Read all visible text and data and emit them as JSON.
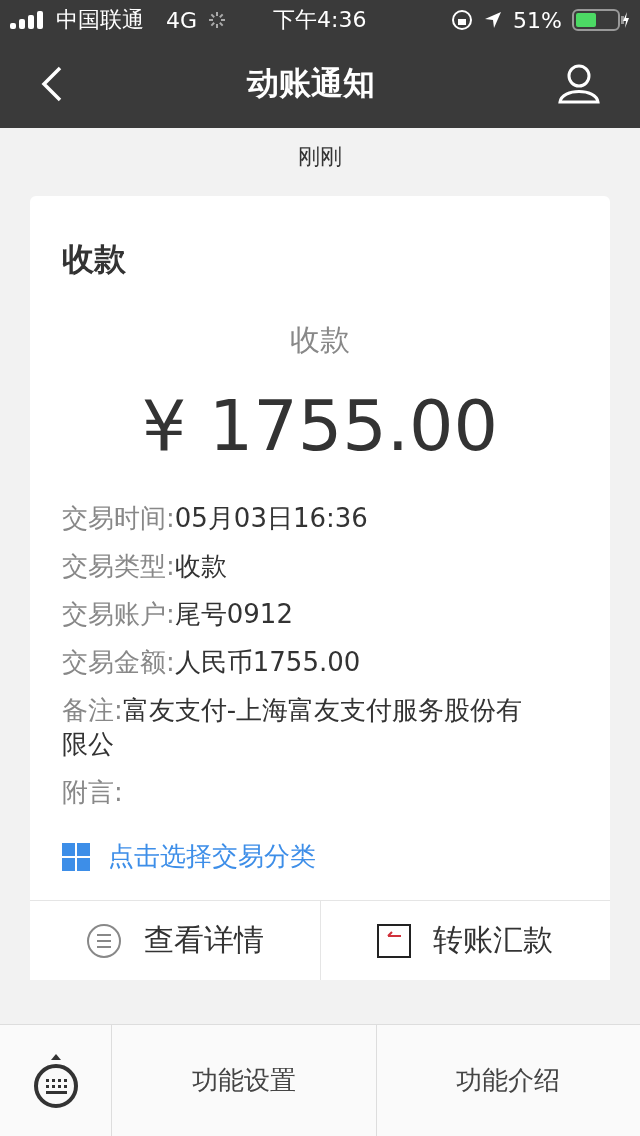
{
  "status_bar": {
    "carrier": "中国联通",
    "network": "4G",
    "time": "下午4:36",
    "battery": "51%"
  },
  "nav": {
    "title": "动账通知"
  },
  "timestamp": "刚刚",
  "card": {
    "title": "收款",
    "type_label": "收款",
    "amount": "¥ 1755.00",
    "details": [
      {
        "label": "交易时间:",
        "value": "05月03日16:36"
      },
      {
        "label": "交易类型:",
        "value": "收款"
      },
      {
        "label": "交易账户:",
        "value": "尾号0912"
      },
      {
        "label": "交易金额:",
        "value": "人民币1755.00"
      },
      {
        "label": "备注:",
        "value": "富友支付-上海富友支付服务股份有限公"
      },
      {
        "label": "附言:"
      }
    ],
    "category_link": "点击选择交易分类",
    "actions": [
      {
        "kind": "details",
        "label": "查看详情"
      },
      {
        "kind": "transfer",
        "label": "转账汇款"
      }
    ]
  },
  "bottom_bar": {
    "items": [
      "功能设置",
      "功能介绍"
    ]
  }
}
